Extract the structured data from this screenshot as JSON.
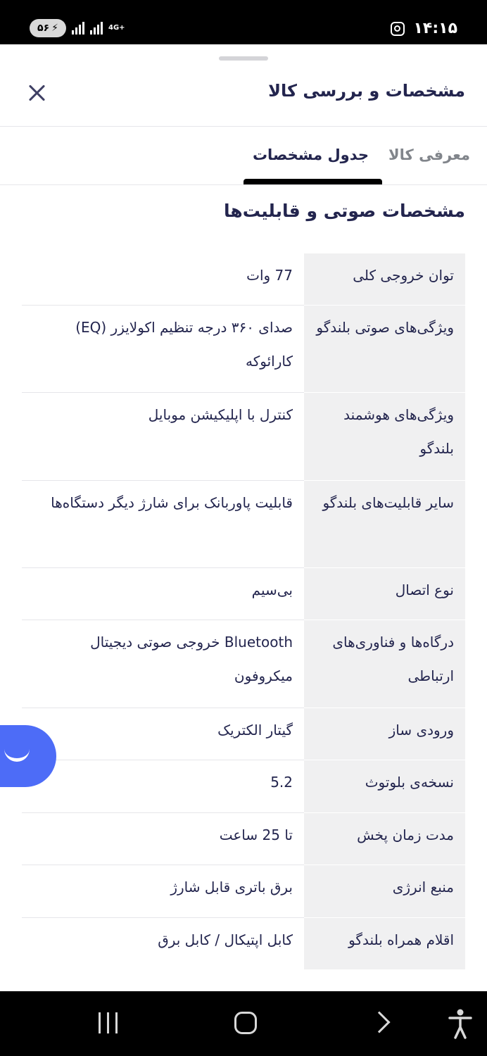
{
  "status_bar": {
    "time": "۱۴:۱۵",
    "battery": "۵۶",
    "network": "4G+"
  },
  "header": {
    "title": "مشخصات و بررسی کالا"
  },
  "tabs": [
    {
      "label": "معرفی کالا",
      "active": false
    },
    {
      "label": "جدول مشخصات",
      "active": true
    }
  ],
  "section": {
    "title": "مشخصات صوتی و قابلیت‌ها"
  },
  "specs": [
    {
      "key": "توان خروجی کلی",
      "value": "77 وات"
    },
    {
      "key": "ویژگی‌های صوتی بلندگو",
      "value": "صدای ۳۶۰ درجه تنظیم اکولایزر (EQ) کارائوکه"
    },
    {
      "key": "ویژگی‌های هوشمند بلندگو",
      "value": "کنترل با اپلیکیشن موبایل"
    },
    {
      "key": "سایر قابلیت‌های بلندگو",
      "value": "قابلیت پاوربانک برای شارژ دیگر دستگاه‌ها"
    },
    {
      "key": "نوع اتصال",
      "value": "بی‌سیم"
    },
    {
      "key": "درگاه‌ها و فناوری‌های ارتباطی",
      "value": "Bluetooth خروجی صوتی دیجیتال میکروفون"
    },
    {
      "key": "ورودی ساز",
      "value": "گیتار الکتریک"
    },
    {
      "key": "نسخه‌ی بلوتوث",
      "value": "5.2"
    },
    {
      "key": "مدت زمان پخش",
      "value": "تا 25 ساعت"
    },
    {
      "key": "منبع انرژی",
      "value": "برق باتری قابل شارژ"
    },
    {
      "key": "اقلام همراه بلندگو",
      "value": "کابل اپتیکال / کابل برق"
    }
  ],
  "icons": {
    "close": "close-icon",
    "chat": "chat-smile-icon",
    "nav_recent": "recent-apps-icon",
    "nav_home": "home-icon",
    "nav_back": "back-icon",
    "nav_accessibility": "accessibility-icon",
    "status_app": "instagram-icon"
  },
  "colors": {
    "text": "#23254e",
    "muted": "#81858b",
    "key_bg": "#f0f0f1",
    "fab": "#4d6cf7"
  }
}
